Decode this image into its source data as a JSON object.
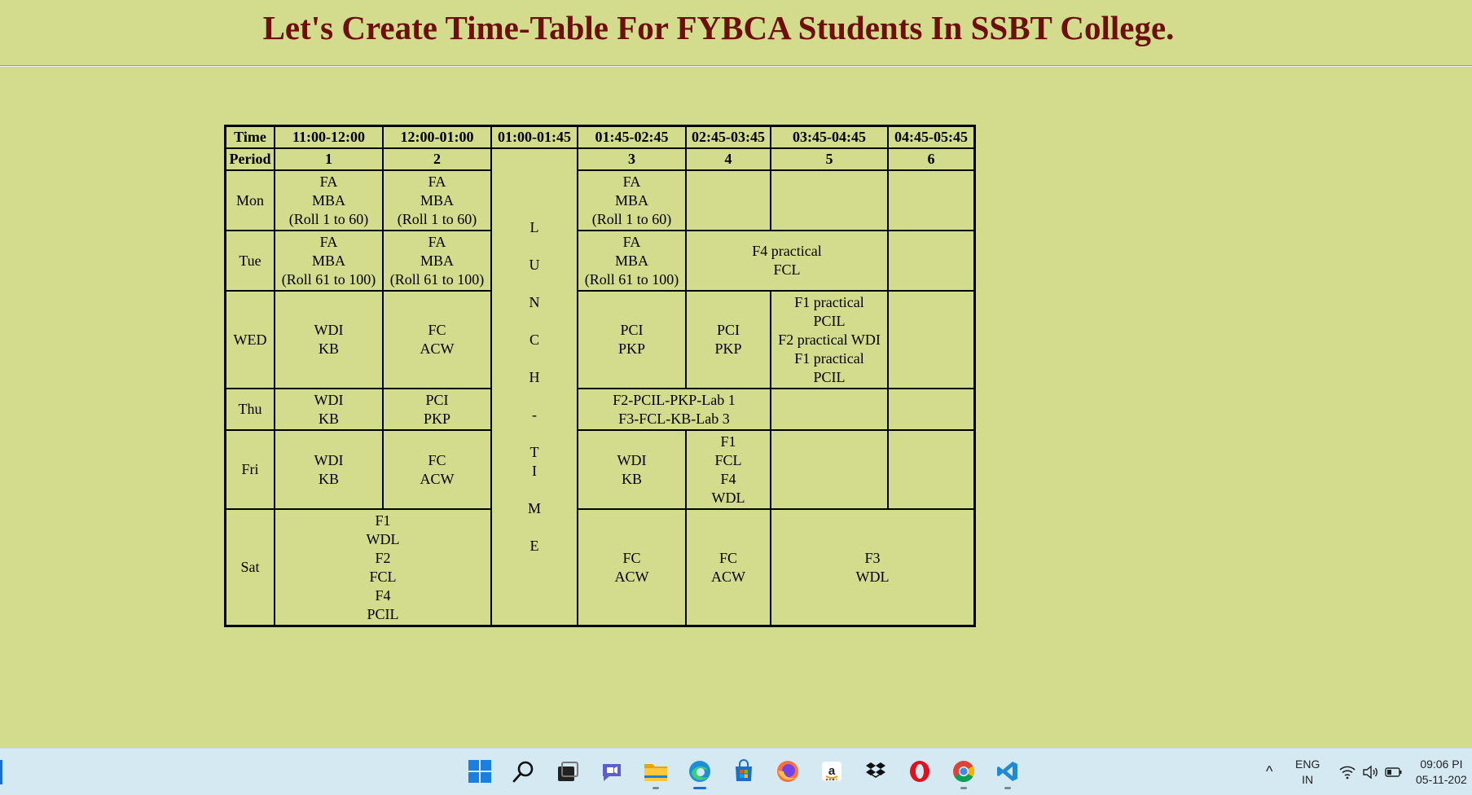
{
  "page": {
    "title": "Let's Create Time-Table For FYBCA Students In SSBT College."
  },
  "timetable": {
    "time_label": "Time",
    "period_label": "Period",
    "times": [
      "11:00-12:00",
      "12:00-01:00",
      "01:00-01:45",
      "01:45-02:45",
      "02:45-03:45",
      "03:45-04:45",
      "04:45-05:45"
    ],
    "periods": [
      "1",
      "2",
      "3",
      "4",
      "5",
      "6"
    ],
    "lunch_letters": [
      "L",
      "U",
      "N",
      "C",
      "H",
      "-",
      "T",
      "I",
      "M",
      "E"
    ],
    "days": {
      "mon": {
        "label": "Mon",
        "p1": [
          "FA",
          "MBA",
          "(Roll 1 to 60)"
        ],
        "p2": [
          "FA",
          "MBA",
          "(Roll 1 to 60)"
        ],
        "p3": [
          "FA",
          "MBA",
          "(Roll 1 to 60)"
        ]
      },
      "tue": {
        "label": "Tue",
        "p1": [
          "FA",
          "MBA",
          "(Roll 61 to 100)"
        ],
        "p2": [
          "FA",
          "MBA",
          "(Roll 61 to 100)"
        ],
        "p3": [
          "FA",
          "MBA",
          "(Roll 61 to 100)"
        ],
        "p4_5": [
          "F4 practical",
          "FCL"
        ]
      },
      "wed": {
        "label": "WED",
        "p1": [
          "WDI",
          "KB"
        ],
        "p2": [
          "FC",
          "ACW"
        ],
        "p3": [
          "PCI",
          "PKP"
        ],
        "p4": [
          "PCI",
          "PKP"
        ],
        "p5": [
          "F1 practical",
          "PCIL",
          "F2 practical WDI",
          "F1 practical",
          "PCIL"
        ]
      },
      "thu": {
        "label": "Thu",
        "p1": [
          "WDI",
          "KB"
        ],
        "p2": [
          "PCI",
          "PKP"
        ],
        "p3_4": [
          "F2-PCIL-PKP-Lab 1",
          "F3-FCL-KB-Lab 3"
        ]
      },
      "fri": {
        "label": "Fri",
        "p1": [
          "WDI",
          "KB"
        ],
        "p2": [
          "FC",
          "ACW"
        ],
        "p3": [
          "WDI",
          "KB"
        ],
        "p4": [
          "F1",
          "FCL",
          "F4",
          "WDL"
        ]
      },
      "sat": {
        "label": "Sat",
        "p1_2": [
          "F1",
          "WDL",
          "F2",
          "FCL",
          "F4",
          "PCIL"
        ],
        "p3": [
          "FC",
          "ACW"
        ],
        "p4": [
          "FC",
          "ACW"
        ],
        "p5_6": [
          "F3",
          "WDL"
        ]
      }
    }
  },
  "taskbar": {
    "icons": [
      "start-icon",
      "search-icon",
      "task-view-icon",
      "chat-icon",
      "file-explorer-icon",
      "edge-icon",
      "store-icon",
      "firefox-icon",
      "amazon-icon",
      "dropbox-icon",
      "opera-icon",
      "chrome-icon",
      "vscode-icon"
    ],
    "tray_chevron": "^",
    "language": "ENG",
    "region": "IN",
    "time": "09:06 PI",
    "date": "05-11-202"
  }
}
